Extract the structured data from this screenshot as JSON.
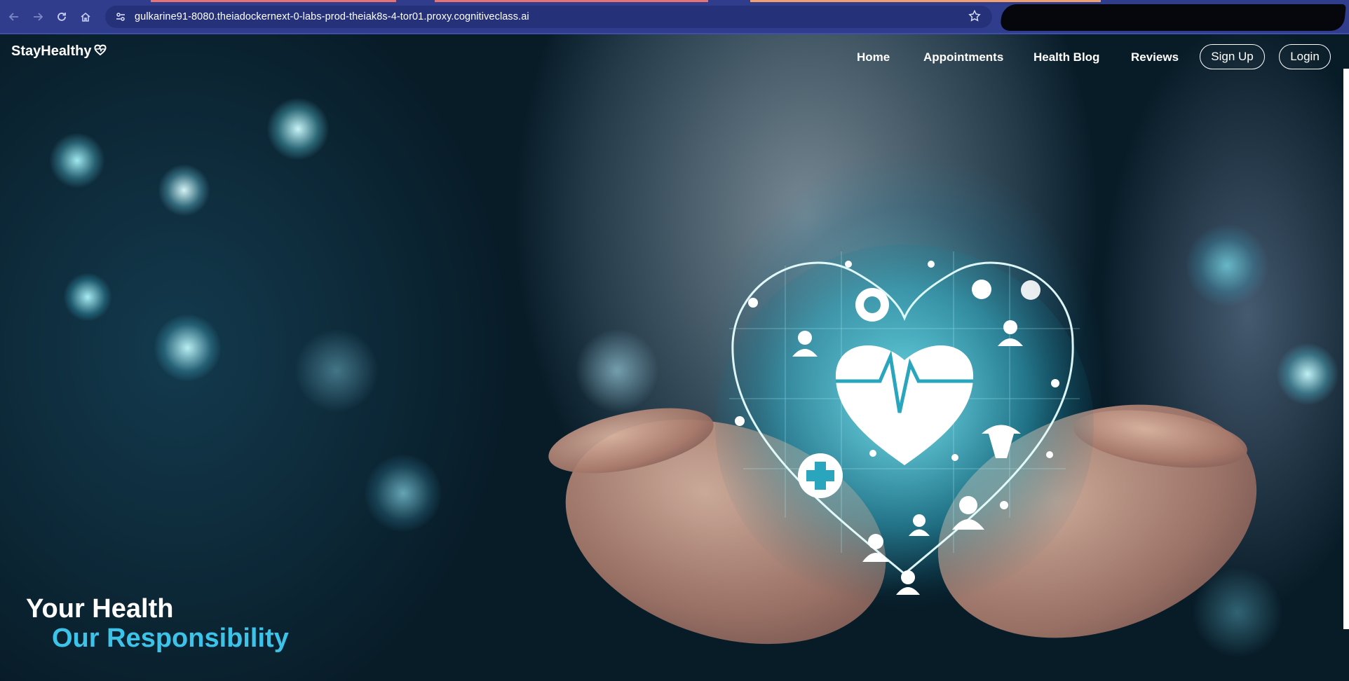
{
  "browser": {
    "url": "gulkarine91-8080.theiadockernext-0-labs-prod-theiak8s-4-tor01.proxy.cognitiveclass.ai",
    "icons": [
      "back-icon",
      "forward-icon",
      "reload-icon",
      "home-icon",
      "site-settings-icon",
      "bookmark-star-icon"
    ]
  },
  "navbar": {
    "brand": "StayHealthy",
    "brand_icon": "heart-outline-icon",
    "links": [
      "Home",
      "Appointments",
      "Health Blog",
      "Reviews"
    ],
    "signup_label": "Sign Up",
    "login_label": "Login"
  },
  "hero": {
    "headline_line1": "Your Health",
    "headline_line2": "Our Responsibility",
    "accent_color": "#3cc3ea"
  }
}
